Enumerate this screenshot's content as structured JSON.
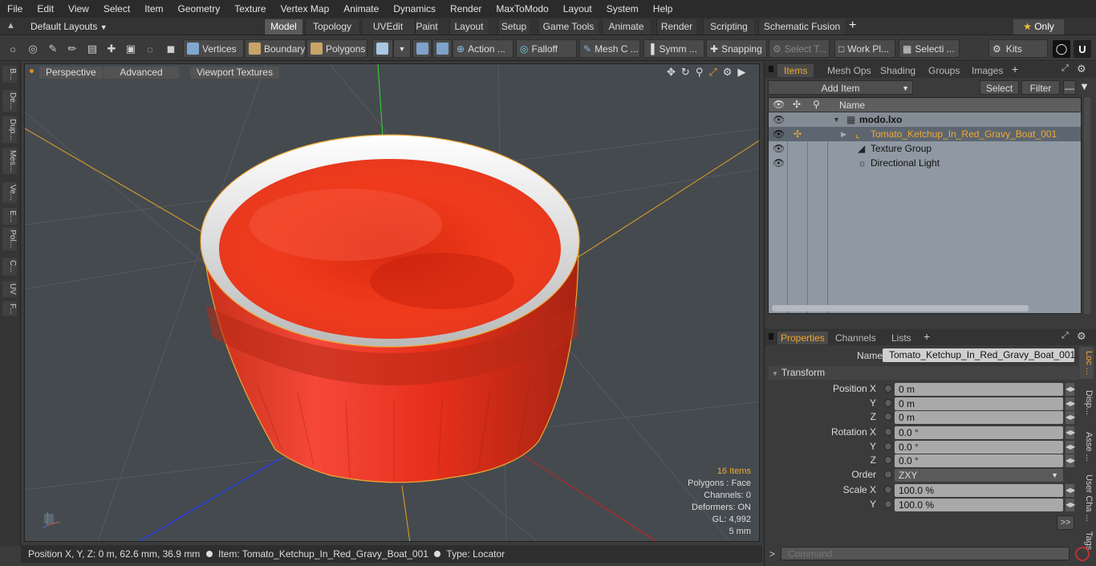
{
  "menu": [
    "File",
    "Edit",
    "View",
    "Select",
    "Item",
    "Geometry",
    "Texture",
    "Vertex Map",
    "Animate",
    "Dynamics",
    "Render",
    "MaxToModo",
    "Layout",
    "System",
    "Help"
  ],
  "layout_selector": "Default Layouts",
  "layout_tabs": [
    "Model",
    "Topology",
    "UVEdit",
    "Paint",
    "Layout",
    "Setup",
    "Game Tools",
    "Animate",
    "Render",
    "Scripting",
    "Schematic Fusion"
  ],
  "active_layout_tab": "Model",
  "only_label": "Only",
  "toolbar": {
    "vertices": "Vertices",
    "boundary": "Boundary",
    "polygons": "Polygons",
    "action": "Action ...",
    "falloff": "Falloff",
    "mesh_c": "Mesh C ...",
    "symm": "Symm ...",
    "snapping": "Snapping",
    "select_t": "Select T...",
    "work_pl": "Work Pl...",
    "selecti": "Selecti ...",
    "kits": "Kits"
  },
  "left_tabs": [
    "B...",
    "De...",
    "Dup...",
    "Mes...",
    "Ve...",
    "E...",
    "Pol...",
    "C...",
    "UV",
    "F..."
  ],
  "viewport": {
    "tabs": [
      "Perspective",
      "Advanced",
      "Viewport Textures"
    ],
    "stats": {
      "items": "16 Items",
      "polygons": "Polygons : Face",
      "channels": "Channels: 0",
      "deformers": "Deformers: ON",
      "gl": "GL: 4,992",
      "scale": "5 mm"
    }
  },
  "status": {
    "position": "Position X, Y, Z:   0 m, 62.6 mm, 36.9 mm",
    "item": "Item:  Tomato_Ketchup_In_Red_Gravy_Boat_001",
    "type": "Type:  Locator"
  },
  "items_panel": {
    "tabs": [
      "Items",
      "Mesh Ops",
      "Shading",
      "Groups",
      "Images"
    ],
    "active_tab": "Items",
    "add_item": "Add Item",
    "select": "Select",
    "filter": "Filter",
    "column_name": "Name",
    "rows": [
      {
        "name": "modo.lxo",
        "selected": false
      },
      {
        "name": "Tomato_Ketchup_In_Red_Gravy_Boat_001",
        "selected": true
      },
      {
        "name": "Texture Group",
        "selected": false
      },
      {
        "name": "Directional Light",
        "selected": false
      }
    ]
  },
  "properties_panel": {
    "tabs": [
      "Properties",
      "Channels",
      "Lists"
    ],
    "active_tab": "Properties",
    "name_label": "Name",
    "name_value": "Tomato_Ketchup_In_Red_Gravy_Boat_001",
    "section": "Transform",
    "fields": [
      {
        "label": "Position X",
        "value": "0 m"
      },
      {
        "label": "Y",
        "value": "0 m"
      },
      {
        "label": "Z",
        "value": "0 m"
      },
      {
        "label": "Rotation X",
        "value": "0.0 °"
      },
      {
        "label": "Y",
        "value": "0.0 °"
      },
      {
        "label": "Z",
        "value": "0.0 °"
      },
      {
        "label": "Order",
        "value": "ZXY"
      },
      {
        "label": "Scale X",
        "value": "100.0 %"
      },
      {
        "label": "Y",
        "value": "100.0 %"
      }
    ],
    "side_tabs": [
      "Loc ...",
      "Disp...",
      "Asse ...",
      "User Cha ...",
      "Tags"
    ],
    "expand": ">>"
  },
  "command_placeholder": "Command",
  "colors": {
    "accent": "#f0a830",
    "viewport_bg": "#454a4f",
    "ketchup": "#e8381c",
    "list_bg": "#8f99a3",
    "selected_row": "#5d6670"
  }
}
